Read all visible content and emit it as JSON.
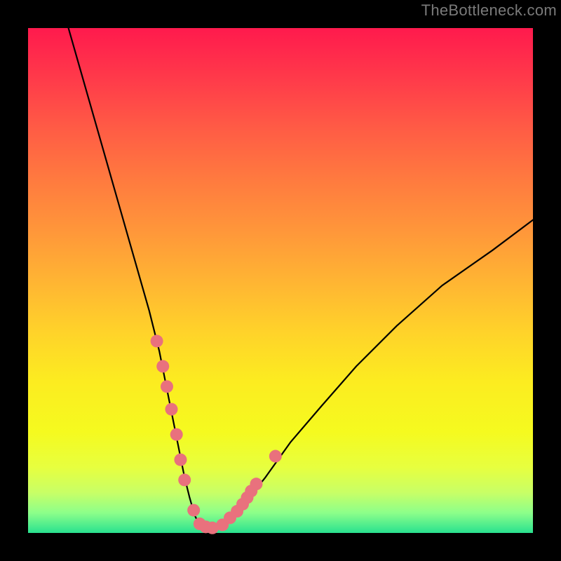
{
  "watermark": "TheBottleneck.com",
  "colors": {
    "marker": "#e9717d",
    "curve": "#000000",
    "frame": "#000000"
  },
  "chart_data": {
    "type": "line",
    "title": "",
    "xlabel": "",
    "ylabel": "",
    "xlim": [
      0,
      100
    ],
    "ylim": [
      0,
      100
    ],
    "grid": false,
    "series": [
      {
        "name": "bottleneck-curve",
        "x": [
          8,
          10,
          12,
          14,
          16,
          18,
          20,
          22,
          24,
          26,
          27,
          28,
          29,
          30,
          31,
          32,
          33,
          34,
          35,
          36,
          37,
          38,
          40,
          43,
          47,
          52,
          58,
          65,
          73,
          82,
          92,
          100
        ],
        "y": [
          100,
          93,
          86,
          79,
          72,
          65,
          58,
          51,
          44,
          36,
          31,
          26,
          21,
          16,
          11,
          7,
          3.5,
          1.5,
          0.8,
          0.5,
          0.6,
          1.2,
          3,
          6,
          11,
          18,
          25,
          33,
          41,
          49,
          56,
          62
        ]
      }
    ],
    "markers": {
      "name": "highlighted-points",
      "x": [
        25.5,
        26.7,
        27.5,
        28.4,
        29.4,
        30.2,
        31.0,
        32.8,
        34.0,
        35.2,
        36.5,
        38.5,
        40.0,
        41.4,
        42.5,
        43.4,
        44.2,
        45.2,
        49.0
      ],
      "y": [
        38,
        33,
        29,
        24.5,
        19.5,
        14.5,
        10.5,
        4.5,
        1.8,
        1.2,
        1.0,
        1.6,
        3.0,
        4.3,
        5.7,
        7.0,
        8.3,
        9.7,
        15.2
      ]
    }
  }
}
